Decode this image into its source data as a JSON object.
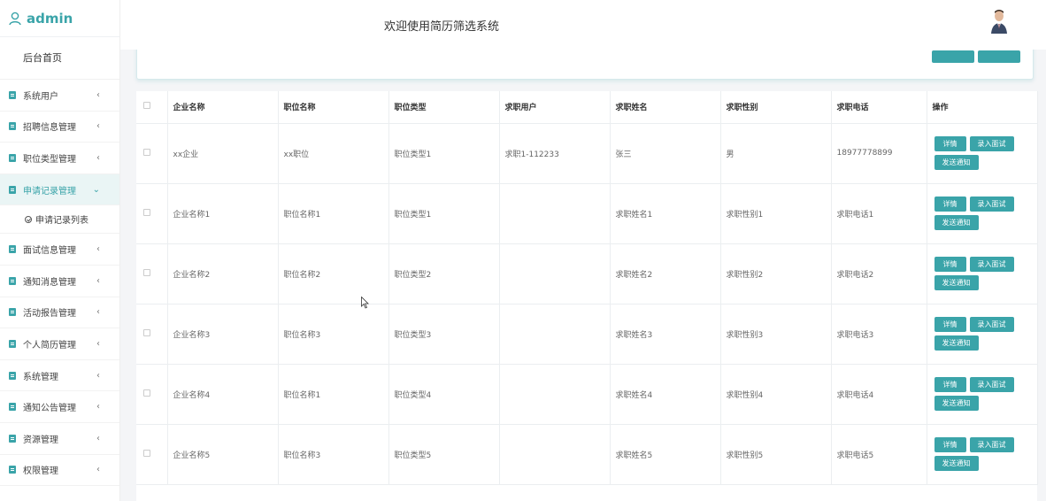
{
  "brand": {
    "name": "admin"
  },
  "header": {
    "title": "欢迎使用简历筛选系统"
  },
  "sidebar": {
    "home": "后台首页",
    "items": [
      {
        "label": "系统用户"
      },
      {
        "label": "招聘信息管理"
      },
      {
        "label": "职位类型管理"
      },
      {
        "label": "申请记录管理",
        "active": true
      },
      {
        "label": "面试信息管理"
      },
      {
        "label": "通知消息管理"
      },
      {
        "label": "活动报告管理"
      },
      {
        "label": "个人简历管理"
      },
      {
        "label": "系统管理"
      },
      {
        "label": "通知公告管理"
      },
      {
        "label": "资源管理"
      },
      {
        "label": "权限管理"
      }
    ],
    "sub_item": "申请记录列表"
  },
  "table": {
    "headers": [
      "企业名称",
      "职位名称",
      "职位类型",
      "求职用户",
      "求职姓名",
      "求职性别",
      "求职电话",
      "操作"
    ],
    "rows": [
      [
        "xx企业",
        "xx职位",
        "职位类型1",
        "求职1-112233",
        "张三",
        "男",
        "18977778899"
      ],
      [
        "企业名称1",
        "职位名称1",
        "职位类型1",
        "",
        "求职姓名1",
        "求职性别1",
        "求职电话1"
      ],
      [
        "企业名称2",
        "职位名称2",
        "职位类型2",
        "",
        "求职姓名2",
        "求职性别2",
        "求职电话2"
      ],
      [
        "企业名称3",
        "职位名称3",
        "职位类型3",
        "",
        "求职姓名3",
        "求职性别3",
        "求职电话3"
      ],
      [
        "企业名称4",
        "职位名称1",
        "职位类型4",
        "",
        "求职姓名4",
        "求职性别4",
        "求职电话4"
      ],
      [
        "企业名称5",
        "职位名称3",
        "职位类型5",
        "",
        "求职姓名5",
        "求职性别5",
        "求职电话5"
      ]
    ],
    "actions": {
      "detail": "详情",
      "enter_interview": "录入面试",
      "send_notice": "发送通知"
    }
  },
  "colors": {
    "accent": "#3aa4a9"
  }
}
